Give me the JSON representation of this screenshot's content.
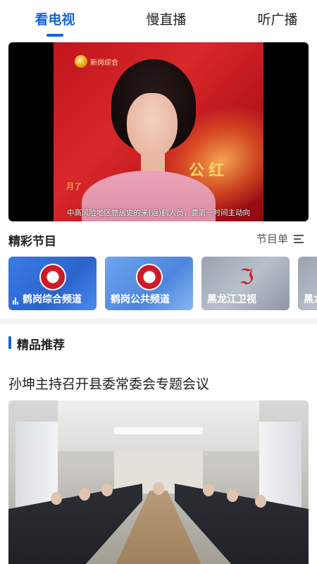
{
  "tabs": [
    {
      "label": "看电视",
      "active": true
    },
    {
      "label": "慢直播",
      "active": false
    },
    {
      "label": "听广播",
      "active": false
    }
  ],
  "player": {
    "station_name": "新岗综合",
    "overlay_text": "公红",
    "overlay_small": "月了",
    "subtitle": "中高风险地区旅居史的来(返)鹤人员，要第一时间主动向"
  },
  "featured": {
    "title": "精彩节目",
    "schedule_label": "节目单"
  },
  "channels": [
    {
      "label": "鹤岗综合频道",
      "logo": "hegang-tv-logo-icon"
    },
    {
      "label": "鹤岗公共频道",
      "logo": "hegang-tv-logo-icon"
    },
    {
      "label": "黑龙江卫视",
      "logo": "heilongjiang-tv-logo-icon"
    },
    {
      "label": "黑龙",
      "logo": "heilongjiang-tv-logo-icon"
    }
  ],
  "recommend": {
    "title": "精品推荐"
  },
  "news": {
    "title": "孙坤主持召开县委常委会专题会议"
  },
  "colors": {
    "accent": "#1565d8",
    "text": "#222222",
    "divider": "#f3f4f6"
  }
}
